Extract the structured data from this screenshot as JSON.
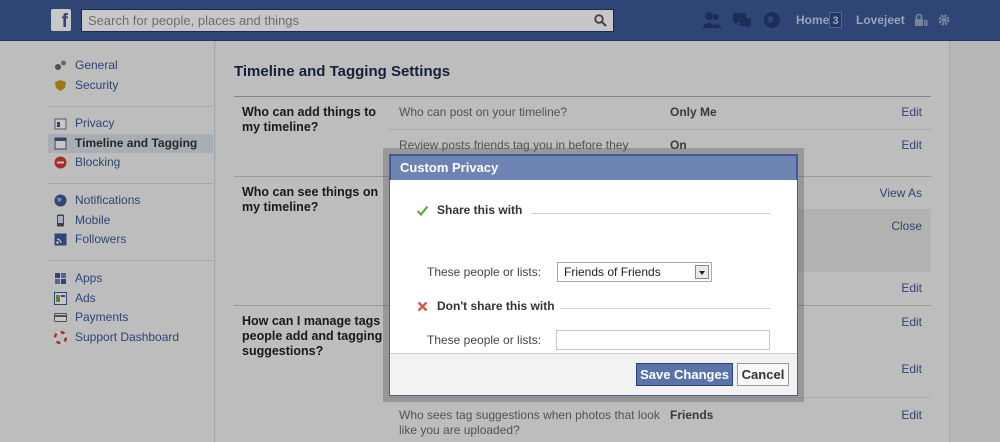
{
  "topbar": {
    "logo": "f",
    "search_placeholder": "Search for people, places and things",
    "home_label": "Home",
    "home_count": "3",
    "user_label": "Lovejeet"
  },
  "sidebar": {
    "group1": [
      {
        "label": "General",
        "icon": "gears-icon"
      },
      {
        "label": "Security",
        "icon": "badge-icon"
      }
    ],
    "group2": [
      {
        "label": "Privacy",
        "icon": "lock-icon"
      },
      {
        "label": "Timeline and Tagging",
        "icon": "timeline-icon"
      },
      {
        "label": "Blocking",
        "icon": "block-icon"
      }
    ],
    "group3": [
      {
        "label": "Notifications",
        "icon": "globe-icon"
      },
      {
        "label": "Mobile",
        "icon": "mobile-icon"
      },
      {
        "label": "Followers",
        "icon": "rss-icon"
      }
    ],
    "group4": [
      {
        "label": "Apps",
        "icon": "apps-icon"
      },
      {
        "label": "Ads",
        "icon": "ads-icon"
      },
      {
        "label": "Payments",
        "icon": "card-icon"
      },
      {
        "label": "Support Dashboard",
        "icon": "lifebuoy-icon"
      }
    ]
  },
  "main": {
    "title": "Timeline and Tagging Settings",
    "section1_heading": "Who can add things to my timeline?",
    "row1": {
      "label": "Who can post on your timeline?",
      "value": "Only Me",
      "action": "Edit"
    },
    "row2": {
      "label": "Review posts friends tag you in before they",
      "value": "On",
      "action": "Edit"
    },
    "section2_heading": "Who can see things on my timeline?",
    "row3_action": "View As",
    "row4_action": "Close",
    "row5_action": "Edit",
    "section3_heading": "How can I manage tags people add and tagging suggestions?",
    "row6_action": "Edit",
    "row7_action": "Edit",
    "row8": {
      "label": "Who sees tag suggestions when photos that look like you are uploaded?",
      "value": "Friends",
      "action": "Edit"
    }
  },
  "dialog": {
    "title": "Custom Privacy",
    "share_heading": "Share this with",
    "share_label": "These people or lists:",
    "share_select_value": "Friends of Friends",
    "dont_share_heading": "Don't share this with",
    "dont_share_label": "These people or lists:",
    "dont_share_value": "",
    "save_label": "Save Changes",
    "cancel_label": "Cancel"
  },
  "colors": {
    "brand": "#3b5998",
    "dialog_header": "#6d84b4",
    "check": "#5fa843",
    "cross": "#d9534f"
  }
}
